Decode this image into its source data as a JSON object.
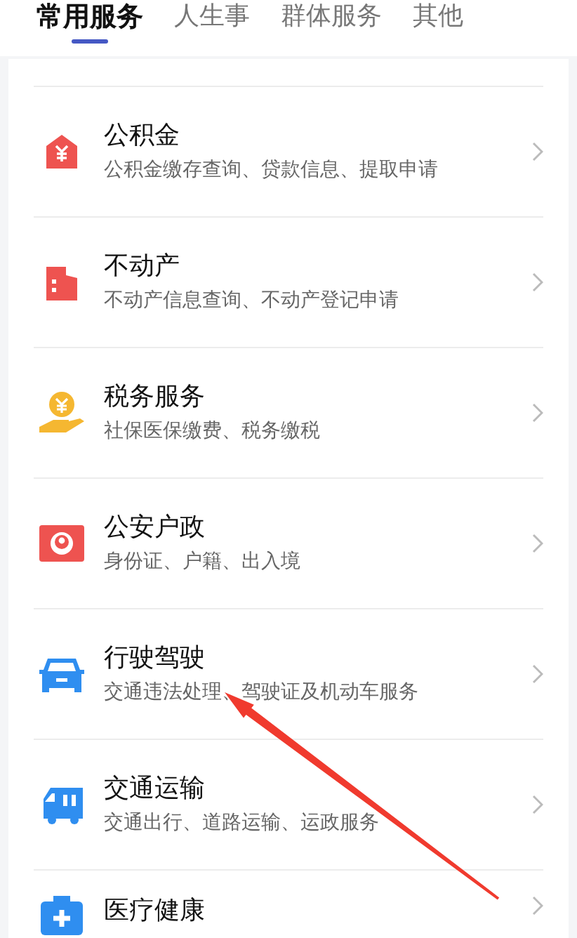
{
  "tabs": [
    {
      "label": "常用服务",
      "selected": true
    },
    {
      "label": "人生事",
      "selected": false
    },
    {
      "label": "群体服务",
      "selected": false
    },
    {
      "label": "其他",
      "selected": false
    }
  ],
  "services": [
    {
      "kind": "fund",
      "title": "公积金",
      "subtitle": "公积金缴存查询、贷款信息、提取申请"
    },
    {
      "kind": "building",
      "title": "不动产",
      "subtitle": "不动产信息查询、不动产登记申请"
    },
    {
      "kind": "tax",
      "title": "税务服务",
      "subtitle": "社保医保缴费、税务缴税"
    },
    {
      "kind": "police",
      "title": "公安户政",
      "subtitle": "身份证、户籍、出入境"
    },
    {
      "kind": "car",
      "title": "行驶驾驶",
      "subtitle": "交通违法处理、驾驶证及机动车服务"
    },
    {
      "kind": "truck",
      "title": "交通运输",
      "subtitle": "交通出行、道路运输、运政服务"
    },
    {
      "kind": "medical",
      "title": "医疗健康"
    }
  ]
}
